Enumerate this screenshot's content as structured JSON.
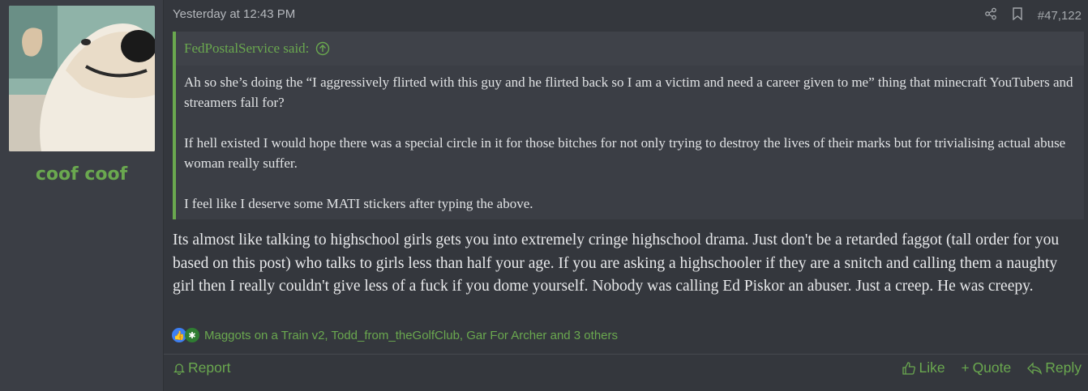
{
  "user": {
    "username": "coof coof",
    "avatar_icon": "dog-avatar-icon"
  },
  "post": {
    "timestamp": "Yesterday at 12:43 PM",
    "post_number": "#47,122",
    "share_icon": "share-icon",
    "bookmark_icon": "bookmark-icon"
  },
  "quote": {
    "author": "FedPostalService said:",
    "paragraphs": [
      "Ah so she’s doing the “I aggressively flirted with this guy and he flirted back so I am a victim and need a career given to me” thing that minecraft YouTubers and streamers fall for?",
      "If hell existed I would hope there was a special circle in it for those bitches for not only trying to destroy the lives of their marks but for trivialising actual abuse woman really suffer.",
      "I feel like I deserve some MATI stickers after typing the above."
    ]
  },
  "message": "Its almost like talking to highschool girls gets you into extremely cringe highschool drama. Just don't be a retarded faggot (tall order for you based on this post) who talks to girls less than half your age. If you are asking a highschooler if they are a snitch and calling them a naughty girl then I really couldn't give less of a fuck if you dome yourself. Nobody was calling Ed Piskor an abuser. Just a creep. He was creepy.",
  "reactions": {
    "text": "Maggots on a Train v2, Todd_from_theGolfClub, Gar For Archer and 3 others"
  },
  "footer": {
    "report": "Report",
    "like": "Like",
    "quote": "Quote",
    "reply": "Reply"
  },
  "colors": {
    "accent": "#6aa84f",
    "background": "#34373d",
    "sidebar": "#3b3e45"
  }
}
